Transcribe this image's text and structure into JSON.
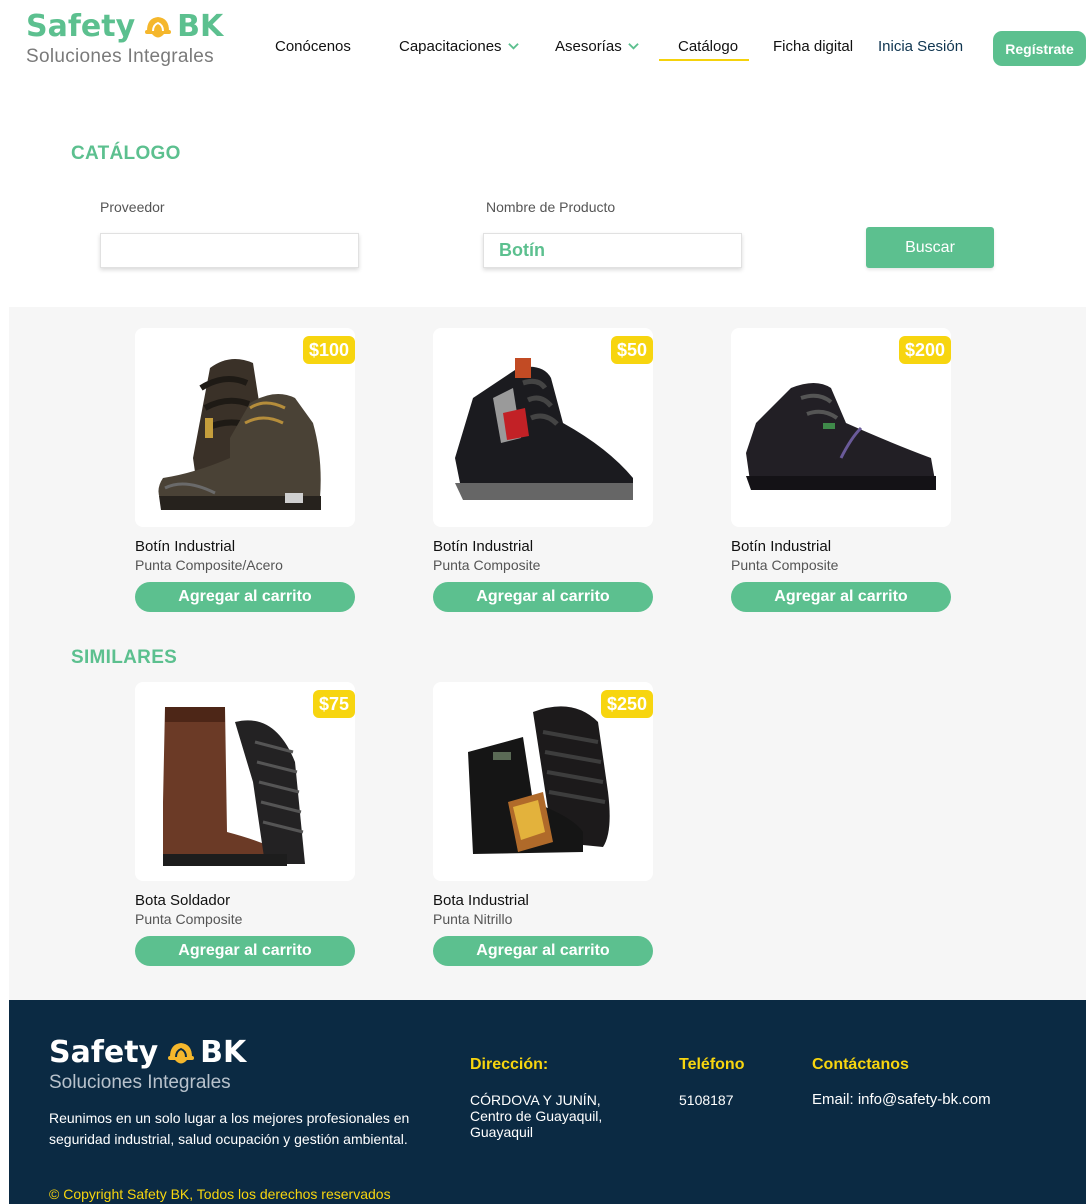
{
  "brand": {
    "name_left": "Safety",
    "name_right": "BK",
    "tagline": "Soluciones Integrales"
  },
  "nav": {
    "items": [
      {
        "label": "Conócenos"
      },
      {
        "label": "Capacitaciones"
      },
      {
        "label": "Asesorías"
      },
      {
        "label": "Catálogo"
      },
      {
        "label": "Ficha digital"
      }
    ],
    "login": "Inicia Sesión",
    "register": "Regístrate"
  },
  "catalog": {
    "title": "CATÁLOGO",
    "provider_label": "Proveedor",
    "provider_value": "",
    "product_label": "Nombre de Producto",
    "product_value": "Botín",
    "search_button": "Buscar"
  },
  "products": [
    {
      "price": "$100",
      "title": "Botín Industrial",
      "desc": "Punta Composite/Acero",
      "button": "Agregar al carrito"
    },
    {
      "price": "$50",
      "title": "Botín Industrial",
      "desc": "Punta Composite",
      "button": "Agregar al carrito"
    },
    {
      "price": "$200",
      "title": "Botín Industrial",
      "desc": "Punta Composite",
      "button": "Agregar al carrito"
    }
  ],
  "similar": {
    "title": "SIMILARES",
    "items": [
      {
        "price": "$75",
        "title": "Bota Soldador",
        "desc": "Punta Composite",
        "button": "Agregar al carrito"
      },
      {
        "price": "$250",
        "title": "Bota Industrial",
        "desc": "Punta Nitrillo",
        "button": "Agregar al carrito"
      }
    ]
  },
  "footer": {
    "about": "Reunimos en un solo lugar a los mejores profesionales en seguridad industrial, salud ocupación y gestión ambiental.",
    "copyright": "© Copyright Safety BK,  Todos los derechos reservados",
    "address_title": "Dirección:",
    "address": "CÓRDOVA Y JUNÍN, Centro de Guayaquil, Guayaquil",
    "phone_title": "Teléfono",
    "phone": "5108187",
    "contact_title": "Contáctanos",
    "email": "Email: info@safety-bk.com"
  },
  "colors": {
    "accent": "#5cc08f",
    "price_badge": "#f7d50f",
    "footer_bg": "#0b2a43",
    "nav_underline": "#f5d20b"
  }
}
